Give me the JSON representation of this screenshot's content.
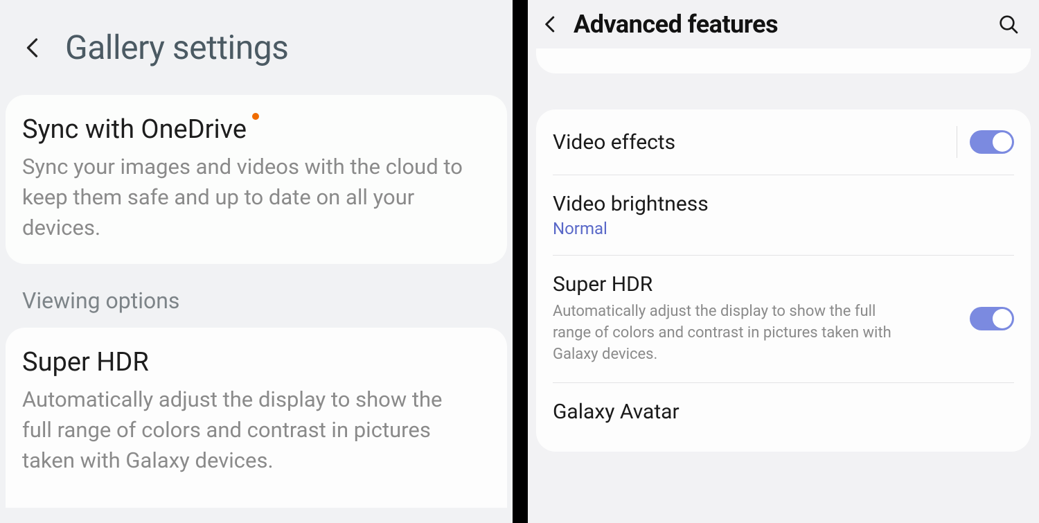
{
  "left": {
    "title": "Gallery settings",
    "sync": {
      "title": "Sync with OneDrive",
      "desc": "Sync your images and videos with the cloud to keep them safe and up to date on all your devices."
    },
    "section_label": "Viewing options",
    "superhdr": {
      "title": "Super HDR",
      "desc": "Automatically adjust the display to show the full range of colors and contrast in pictures taken with Galaxy devices."
    }
  },
  "right": {
    "title": "Advanced features",
    "video_effects": {
      "title": "Video effects",
      "on": true
    },
    "video_brightness": {
      "title": "Video brightness",
      "value": "Normal"
    },
    "superhdr": {
      "title": "Super HDR",
      "desc": "Automatically adjust the display to show the full range of colors and contrast in pictures taken with Galaxy devices.",
      "on": true
    },
    "galaxy_avatar": {
      "title": "Galaxy Avatar"
    }
  }
}
